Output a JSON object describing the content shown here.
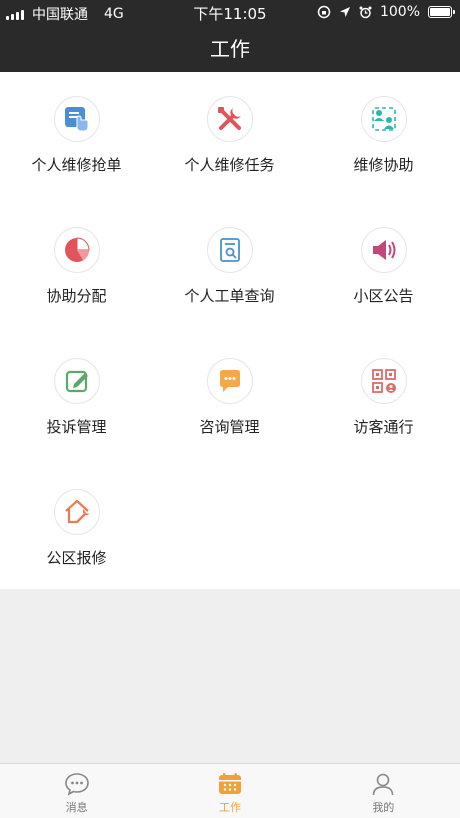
{
  "status_bar": {
    "carrier": "中国联通",
    "network": "4G",
    "time": "下午11:05",
    "battery": "100%"
  },
  "header": {
    "title": "工作"
  },
  "grid": {
    "items": [
      {
        "label": "个人维修抢单",
        "icon": "hand-tap-icon"
      },
      {
        "label": "个人维修任务",
        "icon": "tools-icon"
      },
      {
        "label": "维修协助",
        "icon": "team-assist-icon"
      },
      {
        "label": "协助分配",
        "icon": "pie-chart-icon"
      },
      {
        "label": "个人工单查询",
        "icon": "document-search-icon"
      },
      {
        "label": "小区公告",
        "icon": "speaker-icon"
      },
      {
        "label": "投诉管理",
        "icon": "edit-icon"
      },
      {
        "label": "咨询管理",
        "icon": "chat-bubble-icon"
      },
      {
        "label": "访客通行",
        "icon": "qr-visitor-icon"
      },
      {
        "label": "公区报修",
        "icon": "house-wrench-icon"
      }
    ]
  },
  "tabbar": {
    "tabs": [
      {
        "label": "消息",
        "icon": "message-icon"
      },
      {
        "label": "工作",
        "icon": "calendar-icon",
        "active": true
      },
      {
        "label": "我的",
        "icon": "user-icon"
      }
    ]
  },
  "colors": {
    "header_bg": "#2a2a2a",
    "accent": "#f0a23a",
    "blue": "#4a8fd6",
    "red": "#e0555a",
    "teal": "#2bb6b0",
    "green": "#5aa96a",
    "magenta": "#c2457c"
  }
}
